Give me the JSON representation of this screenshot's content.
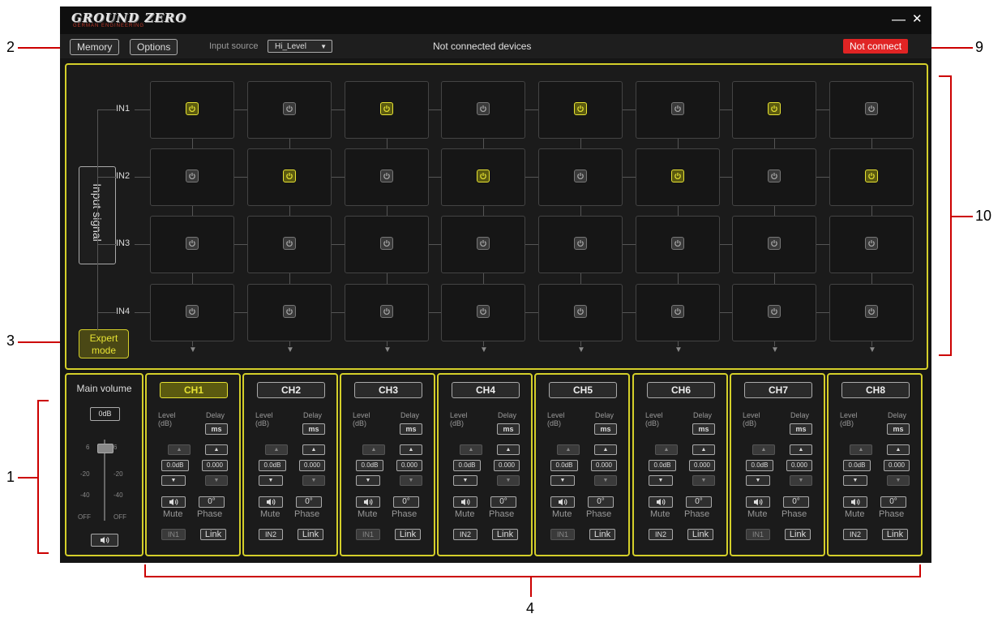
{
  "app": {
    "logo": "GROUND ZERO",
    "logo_sub": "GERMAN ENGINEERING",
    "minimize": "—",
    "close": "✕"
  },
  "toolbar": {
    "memory_label": "Memory",
    "options_label": "Options",
    "input_source_label": "Input source",
    "input_source_value": "Hi_Level",
    "status_text": "Not connected devices",
    "not_connect_label": "Not connect"
  },
  "matrix": {
    "input_signal_label": "Input signal",
    "expert_mode_label": "Expert mode",
    "rows": [
      {
        "label": "IN1",
        "states": [
          true,
          false,
          true,
          false,
          true,
          false,
          true,
          false
        ]
      },
      {
        "label": "IN2",
        "states": [
          false,
          true,
          false,
          true,
          false,
          true,
          false,
          true
        ]
      },
      {
        "label": "IN3",
        "states": [
          false,
          false,
          false,
          false,
          false,
          false,
          false,
          false
        ]
      },
      {
        "label": "IN4",
        "states": [
          false,
          false,
          false,
          false,
          false,
          false,
          false,
          false
        ]
      }
    ]
  },
  "main_volume": {
    "title": "Main volume",
    "value": "0dB",
    "ticks": [
      "6",
      "-20",
      "-40",
      "OFF"
    ]
  },
  "channels": [
    {
      "name": "CH1",
      "level": "0.0dB",
      "delay": "0.000",
      "input": "IN1",
      "active": true
    },
    {
      "name": "CH2",
      "level": "0.0dB",
      "delay": "0.000",
      "input": "IN2",
      "active": false
    },
    {
      "name": "CH3",
      "level": "0.0dB",
      "delay": "0.000",
      "input": "IN1",
      "active": false
    },
    {
      "name": "CH4",
      "level": "0.0dB",
      "delay": "0.000",
      "input": "IN2",
      "active": false
    },
    {
      "name": "CH5",
      "level": "0.0dB",
      "delay": "0.000",
      "input": "IN1",
      "active": false
    },
    {
      "name": "CH6",
      "level": "0.0dB",
      "delay": "0.000",
      "input": "IN2",
      "active": false
    },
    {
      "name": "CH7",
      "level": "0.0dB",
      "delay": "0.000",
      "input": "IN1",
      "active": false
    },
    {
      "name": "CH8",
      "level": "0.0dB",
      "delay": "0.000",
      "input": "IN2",
      "active": false
    }
  ],
  "channel_labels": {
    "level": "Level",
    "level_unit": "(dB)",
    "delay": "Delay",
    "delay_unit": "ms",
    "phase_value": "0°",
    "mute": "Mute",
    "phase": "Phase",
    "link": "Link"
  },
  "annotations": [
    "1",
    "2",
    "3",
    "4",
    "9",
    "10"
  ],
  "colors": {
    "accent": "#d4cf2a",
    "active_power": "#e6e233",
    "error_red": "#e02424",
    "callout_red": "#cc0000"
  },
  "icons": {
    "power": "power-icon",
    "speaker": "speaker-icon",
    "triangle_up": "▲",
    "triangle_down": "▼",
    "arrow_down": "▼",
    "dropdown": "▼"
  }
}
